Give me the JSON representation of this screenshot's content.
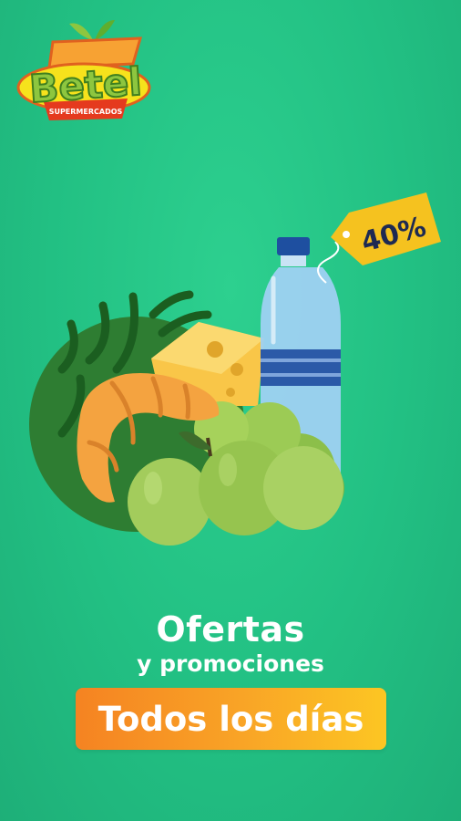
{
  "brand": {
    "name": "Betel",
    "tagline": "SUPERMERCADOS"
  },
  "promo": {
    "discount_tag": "40%",
    "headline": "Ofertas",
    "subheadline": "y promociones",
    "cta_label": "Todos los días"
  },
  "colors": {
    "background": "#22c083",
    "cta_start": "#f58322",
    "cta_end": "#fcc623",
    "tag": "#f5c21f",
    "tag_text": "#1e2a52"
  }
}
